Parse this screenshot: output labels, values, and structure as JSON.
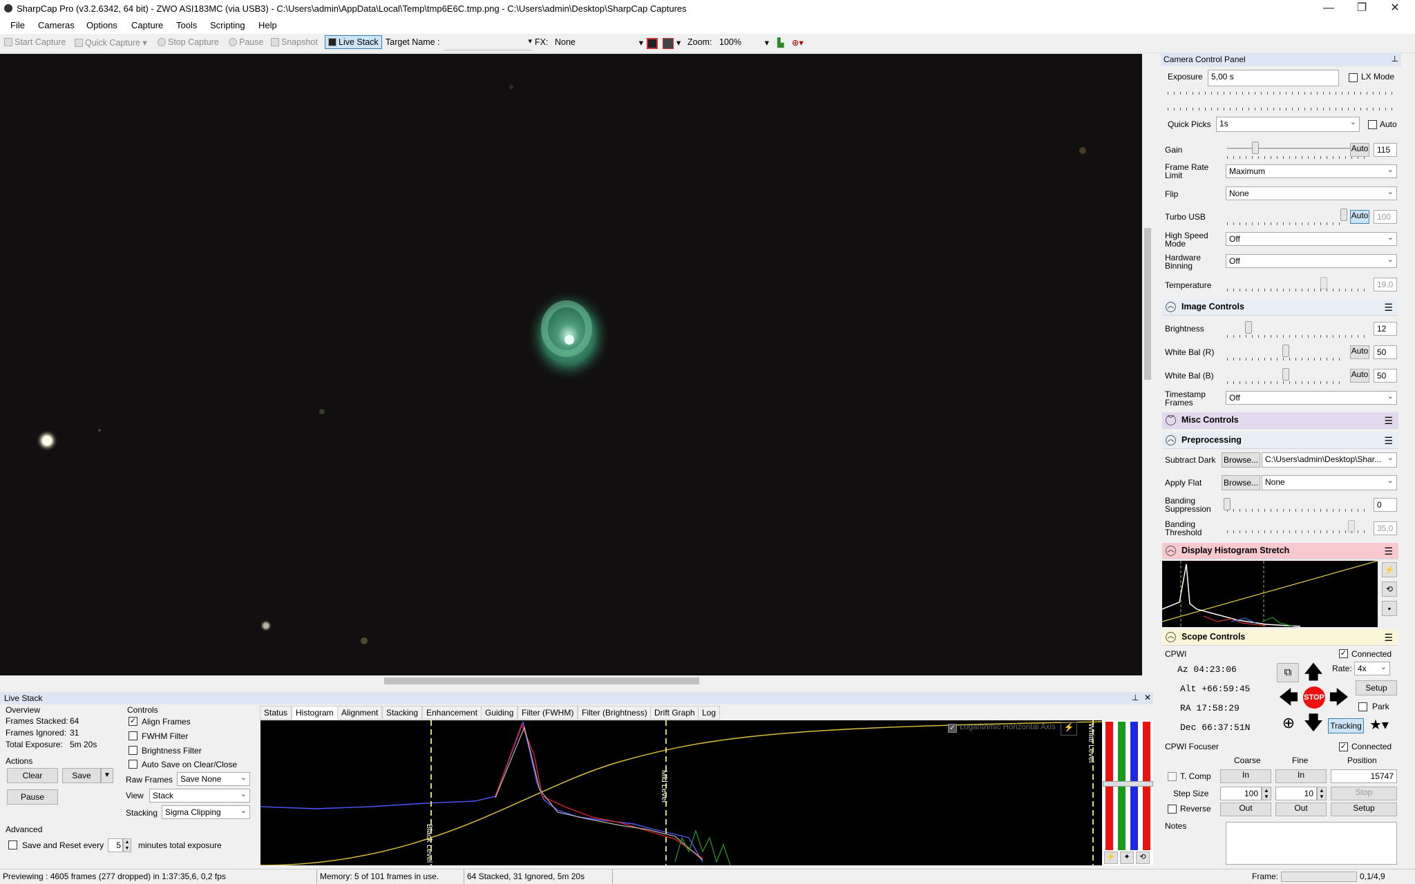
{
  "window": {
    "title": "SharpCap Pro (v3.2.6342, 64 bit) - ZWO ASI183MC (via USB3) - C:\\Users\\admin\\AppData\\Local\\Temp\\tmp6E6C.tmp.png - C:\\Users\\admin\\Desktop\\SharpCap Captures",
    "minimize": "—",
    "maximize": "❐",
    "close": "✕"
  },
  "menu": [
    "File",
    "Cameras",
    "Options",
    "Capture",
    "Tools",
    "Scripting",
    "Help"
  ],
  "toolbar": {
    "start_capture": "Start Capture",
    "quick_capture": "Quick Capture",
    "stop_capture": "Stop Capture",
    "pause": "Pause",
    "snapshot": "Snapshot",
    "live_stack": "Live Stack",
    "target_name_label": "Target Name :",
    "target_name_value": "",
    "fx_label": "FX:",
    "fx_value": "None",
    "zoom_label": "Zoom:",
    "zoom_value": "100%"
  },
  "camera_panel": {
    "title": "Camera Control Panel",
    "exposure_label": "Exposure",
    "exposure_value": "5,00 s",
    "lx_mode": "LX Mode",
    "quick_picks_label": "Quick Picks",
    "quick_picks_value": "1s",
    "auto": "Auto",
    "gain_label": "Gain",
    "gain_auto": "Auto",
    "gain_value": "115",
    "frame_rate_label": "Frame Rate Limit",
    "frame_rate_value": "Maximum",
    "flip_label": "Flip",
    "flip_value": "None",
    "turbo_label": "Turbo USB",
    "turbo_auto": "Auto",
    "turbo_value": "100",
    "high_speed_label": "High Speed Mode",
    "high_speed_value": "Off",
    "binning_label": "Hardware Binning",
    "binning_value": "Off",
    "temperature_label": "Temperature",
    "temperature_value": "19,0"
  },
  "image_controls": {
    "title": "Image Controls",
    "brightness_label": "Brightness",
    "brightness_value": "12",
    "wb_r_label": "White Bal (R)",
    "wb_r_auto": "Auto",
    "wb_r_value": "50",
    "wb_b_label": "White Bal (B)",
    "wb_b_auto": "Auto",
    "wb_b_value": "50",
    "timestamp_label": "Timestamp Frames",
    "timestamp_value": "Off"
  },
  "misc_controls": {
    "title": "Misc Controls"
  },
  "preprocessing": {
    "title": "Preprocessing",
    "subtract_dark_label": "Subtract Dark",
    "browse": "Browse...",
    "subtract_dark_value": "C:\\Users\\admin\\Desktop\\Shar...",
    "apply_flat_label": "Apply Flat",
    "apply_flat_value": "None",
    "banding_supp_label": "Banding Suppression",
    "banding_supp_value": "0",
    "banding_thresh_label": "Banding Threshold",
    "banding_thresh_value": "35,0"
  },
  "display_stretch": {
    "title": "Display Histogram Stretch"
  },
  "scope": {
    "title": "Scope Controls",
    "name": "CPWI",
    "connected": "Connected",
    "az": "Az  04:23:06",
    "alt": "Alt +66:59:45",
    "ra": "RA  17:58:29",
    "dec": "Dec 66:37:51N",
    "rate_label": "Rate:",
    "rate_value": "4x",
    "setup": "Setup",
    "park": "Park",
    "stop": "STOP",
    "tracking": "Tracking"
  },
  "focuser": {
    "name": "CPWI Focuser",
    "connected": "Connected",
    "coarse": "Coarse",
    "fine": "Fine",
    "position": "Position",
    "tcomp": "T. Comp",
    "in": "In",
    "position_value": "15747",
    "step_size_label": "Step Size",
    "coarse_step": "100",
    "fine_step": "10",
    "stop": "Stop",
    "reverse": "Reverse",
    "out": "Out",
    "setup": "Setup",
    "notes": "Notes"
  },
  "live_stack": {
    "title": "Live Stack",
    "overview": "Overview",
    "frames_stacked_label": "Frames Stacked:",
    "frames_stacked": "64",
    "frames_ignored_label": "Frames Ignored:",
    "frames_ignored": "31",
    "total_exposure_label": "Total Exposure:",
    "total_exposure": "5m 20s",
    "actions": "Actions",
    "clear": "Clear",
    "save": "Save",
    "pause": "Pause",
    "advanced": "Advanced",
    "save_reset_label": "Save and Reset every",
    "save_reset_value": "5",
    "save_reset_suffix": "minutes total exposure",
    "controls": "Controls",
    "align_frames": "Align Frames",
    "fwhm_filter": "FWHM Filter",
    "brightness_filter": "Brightness Filter",
    "auto_save": "Auto Save on Clear/Close",
    "raw_frames_label": "Raw Frames",
    "raw_frames_value": "Save None",
    "view_label": "View",
    "view_value": "Stack",
    "stacking_label": "Stacking",
    "stacking_value": "Sigma Clipping",
    "tabs": [
      "Status",
      "Histogram",
      "Alignment",
      "Stacking",
      "Enhancement",
      "Guiding",
      "Filter (FWHM)",
      "Filter (Brightness)",
      "Drift Graph",
      "Log"
    ],
    "log_axis": "Logarithmic Horizontal Axis",
    "black_level": "Black Level",
    "mid_level": "Mid Level",
    "white_level": "White Level"
  },
  "statusbar": {
    "preview": "Previewing : 4605 frames (277 dropped) in 1:37:35,6, 0,2 fps",
    "memory": "Memory: 5 of 101 frames in use.",
    "stack": "64 Stacked, 31 Ignored, 5m 20s",
    "frame_label": "Frame:",
    "frame_value": "0,1/4,9"
  },
  "colors": {
    "accent": "#3c7fb1",
    "misc": "#e3d9ef",
    "stretch": "#f7c9cf",
    "scope": "#fbf5d8"
  }
}
